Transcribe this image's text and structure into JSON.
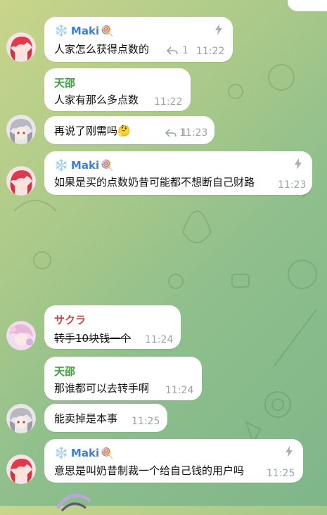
{
  "messages": [
    {
      "sender": "Maki",
      "sender_prefix": "❄️",
      "sender_suffix": "🍭",
      "text": "人家怎么获得点数的",
      "reply_count": "1",
      "time": "11:22",
      "sender_color": "#3d7fd6"
    },
    {
      "sender": "天邵",
      "text": "人家有那么多点数",
      "time": "11:22",
      "sender_color": "#3aa13a"
    },
    {
      "text": "再说了刚需吗🤔",
      "reply_count": "1",
      "time": "11:23"
    },
    {
      "sender": "Maki",
      "sender_prefix": "❄️",
      "sender_suffix": "🍭",
      "text": "如果是买的点数奶昔可能都不想断自己财路",
      "time": "11:23",
      "sender_color": "#3d7fd6"
    },
    {
      "sender": "サクラ",
      "text": "转手10块钱一个",
      "time": "11:24",
      "sender_color": "#c94a4a"
    },
    {
      "sender": "天邵",
      "text": "那谁都可以去转手啊",
      "time": "11:24",
      "sender_color": "#3aa13a"
    },
    {
      "text": "能卖掉是本事",
      "time": "11:25"
    },
    {
      "sender": "Maki",
      "sender_prefix": "❄️",
      "sender_suffix": "🍭",
      "text": "意思是叫奶昔制裁一个给自己钱的用户吗",
      "time": "11:25",
      "sender_color": "#3d7fd6"
    }
  ],
  "icons": {
    "bolt": "lightning-icon",
    "reply": "reply-arrow-icon"
  },
  "colors": {
    "bubble": "#ffffff",
    "time": "#9aa3ab"
  }
}
